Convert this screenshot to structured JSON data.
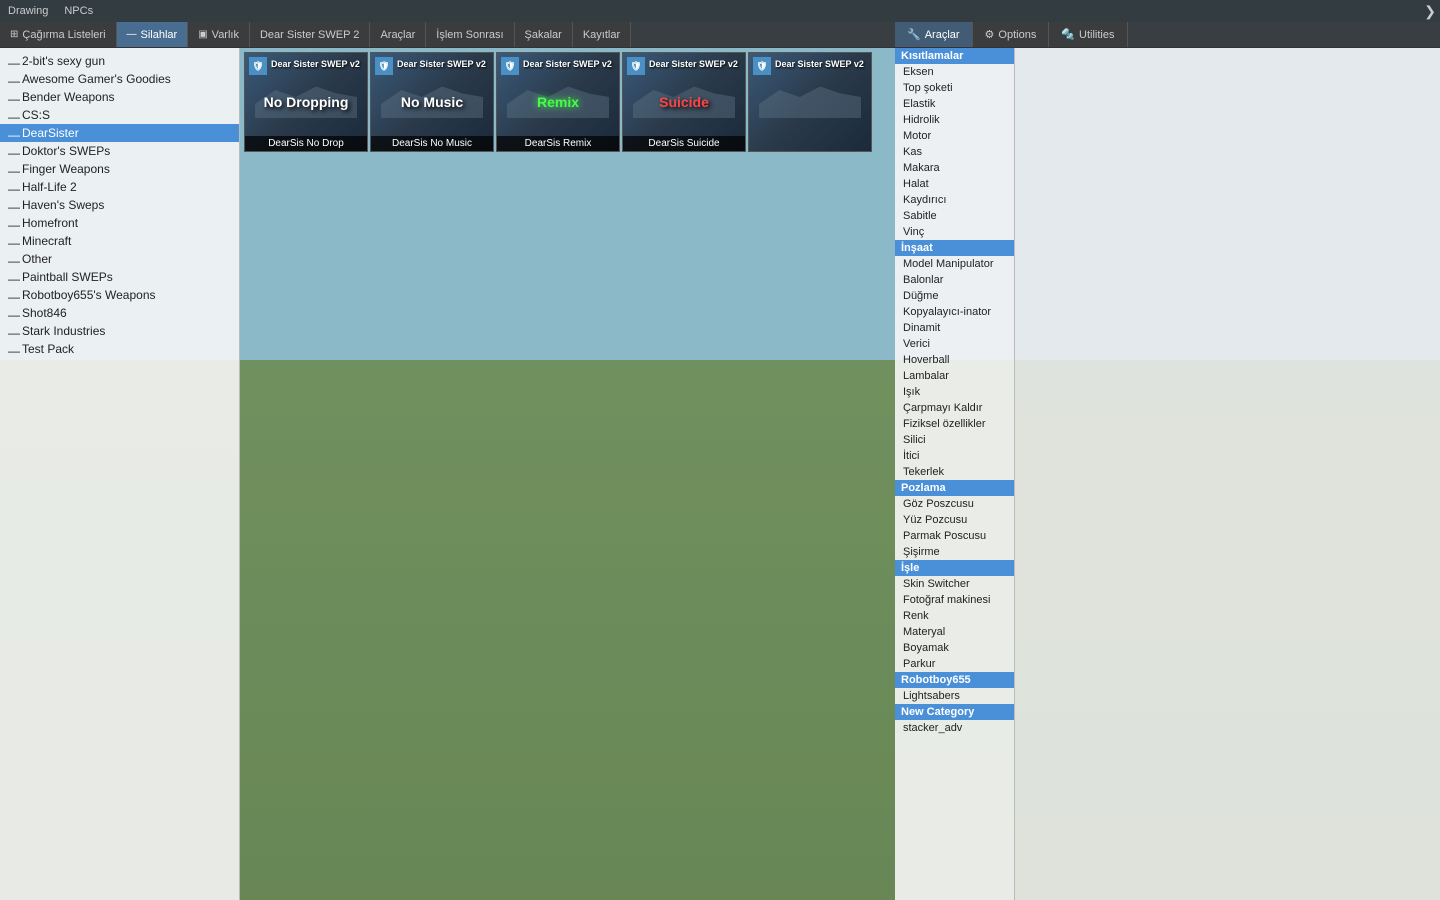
{
  "topbar": {
    "items": [
      "Drawing",
      "NPCs"
    ],
    "arrow": "❯"
  },
  "tabs": [
    {
      "id": "summon",
      "label": "Çağırma Listeleri",
      "icon": "⊞",
      "active": false
    },
    {
      "id": "weapons",
      "label": "Silahlar",
      "icon": "🔫",
      "active": true
    },
    {
      "id": "entities",
      "label": "Varlık",
      "icon": "▣",
      "active": false
    },
    {
      "id": "dear",
      "label": "Dear Sister SWEP 2",
      "icon": "",
      "active": false
    },
    {
      "id": "tools",
      "label": "Araçlar",
      "icon": "🔧",
      "active": false
    },
    {
      "id": "post",
      "label": "İşlem Sonrası",
      "icon": "⚙",
      "active": false
    },
    {
      "id": "jokes",
      "label": "Şakalar",
      "icon": "😂",
      "active": false
    },
    {
      "id": "saves",
      "label": "Kayıtlar",
      "icon": "💾",
      "active": false
    }
  ],
  "sidebar": {
    "items": [
      {
        "label": "2-bit's sexy gun",
        "selected": false
      },
      {
        "label": "Awesome Gamer's Goodies",
        "selected": false
      },
      {
        "label": "Bender Weapons",
        "selected": false
      },
      {
        "label": "CS:S",
        "selected": false
      },
      {
        "label": "DearSister",
        "selected": true
      },
      {
        "label": "Doktor's SWEPs",
        "selected": false
      },
      {
        "label": "Finger Weapons",
        "selected": false
      },
      {
        "label": "Half-Life 2",
        "selected": false
      },
      {
        "label": "Haven's Sweps",
        "selected": false
      },
      {
        "label": "Homefront",
        "selected": false
      },
      {
        "label": "Minecraft",
        "selected": false
      },
      {
        "label": "Other",
        "selected": false
      },
      {
        "label": "Paintball SWEPs",
        "selected": false
      },
      {
        "label": "Robotboy655's Weapons",
        "selected": false
      },
      {
        "label": "Shot846",
        "selected": false
      },
      {
        "label": "Stark Industries",
        "selected": false
      },
      {
        "label": "Test Pack",
        "selected": false
      }
    ]
  },
  "weapons": [
    {
      "title": "Dear Sister SWEP v2",
      "name": "DearSis No Drop",
      "centerText": "No Dropping",
      "centerClass": "",
      "hasBadge": true
    },
    {
      "title": "Dear Sister SWEP v2",
      "name": "DearSis No Music",
      "centerText": "No Music",
      "centerClass": "",
      "hasBadge": true
    },
    {
      "title": "Dear Sister SWEP v2",
      "name": "DearSis Remix",
      "centerText": "Remix",
      "centerClass": "green",
      "hasBadge": true
    },
    {
      "title": "Dear Sister SWEP v2",
      "name": "DearSis Suicide",
      "centerText": "Suicide",
      "centerClass": "red",
      "hasBadge": true
    },
    {
      "title": "Dear Sister SWEP v2",
      "name": "",
      "centerText": "",
      "centerClass": "",
      "hasBadge": true
    }
  ],
  "rightTabs": [
    {
      "label": "Araçlar",
      "icon": "🔧",
      "active": true
    },
    {
      "label": "Options",
      "icon": "⚙",
      "active": false
    },
    {
      "label": "Utilities",
      "icon": "🔩",
      "active": false
    }
  ],
  "toolsSections": [
    {
      "header": "Kısıtlamalar",
      "items": [
        "Eksen",
        "Top şoketi",
        "Elastik",
        "Hidrolik",
        "Motor",
        "Kas",
        "Makara",
        "Halat",
        "Kaydırıcı",
        "Sabitle",
        "Vinç"
      ]
    },
    {
      "header": "İnşaat",
      "items": [
        "Model Manipulator",
        "Balonlar",
        "Düğme",
        "Kopyalayıcı-inator",
        "Dinamit",
        "Verici",
        "Hoverball",
        "Lambalar",
        "Işık",
        "Çarpmayı Kaldır",
        "Fiziksel özellikler",
        "Silici",
        "İtici",
        "Tekerlek"
      ]
    },
    {
      "header": "Pozlama",
      "items": [
        "Göz Poszcusu",
        "Yüz Pozcusu",
        "Parmak Poscusu",
        "Şişirme"
      ]
    },
    {
      "header": "İşle",
      "items": [
        "Skin Switcher",
        "Fotoğraf makinesi",
        "Renk",
        "Materyal",
        "Boyamak",
        "Parkur"
      ]
    },
    {
      "header": "Robotboy655",
      "items": [
        "Lightsabers"
      ]
    },
    {
      "header": "New Category",
      "items": [
        "stacker_adv"
      ]
    }
  ]
}
